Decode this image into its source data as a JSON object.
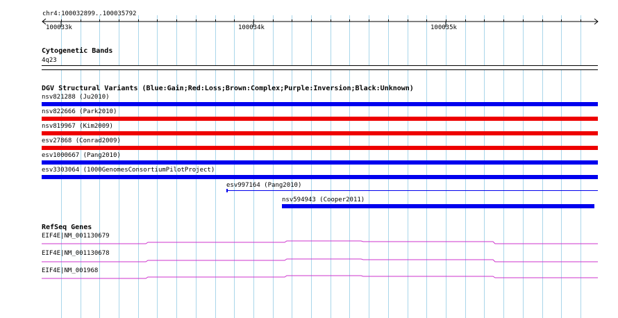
{
  "ruler": {
    "location": "chr4:100032899..100035792",
    "ticks": [
      "100033k",
      "100034k",
      "100035k"
    ]
  },
  "cytoband": {
    "title": "Cytogenetic Bands",
    "band": "4q23"
  },
  "dgv": {
    "title": "DGV Structural Variants (Blue:Gain;Red:Loss;Brown:Complex;Purple:Inversion;Black:Unknown)",
    "colors": {
      "gain": "#0000ee",
      "loss": "#ee0000"
    },
    "variants": [
      {
        "label": "nsv821288 (Ju2010)",
        "type": "gain"
      },
      {
        "label": "nsv822666 (Park2010)",
        "type": "loss"
      },
      {
        "label": "nsv819967 (Kim2009)",
        "type": "loss"
      },
      {
        "label": "esv27868 (Conrad2009)",
        "type": "loss"
      },
      {
        "label": "esv1000667 (Pang2010)",
        "type": "gain"
      },
      {
        "label": "esv3303064 (1000GenomesConsortiumPilotProject)",
        "type": "gain"
      },
      {
        "label": "esv997164 (Pang2010)",
        "type": "gain"
      },
      {
        "label": "nsv594943 (Cooper2011)",
        "type": "gain"
      }
    ]
  },
  "refseq": {
    "title": "RefSeq Genes",
    "color": "#cc33cc",
    "genes": [
      {
        "label": "EIF4E|NM_001130679"
      },
      {
        "label": "EIF4E|NM_001130678"
      },
      {
        "label": "EIF4E|NM_001968"
      }
    ]
  },
  "grid_color": "#a9d6ea"
}
